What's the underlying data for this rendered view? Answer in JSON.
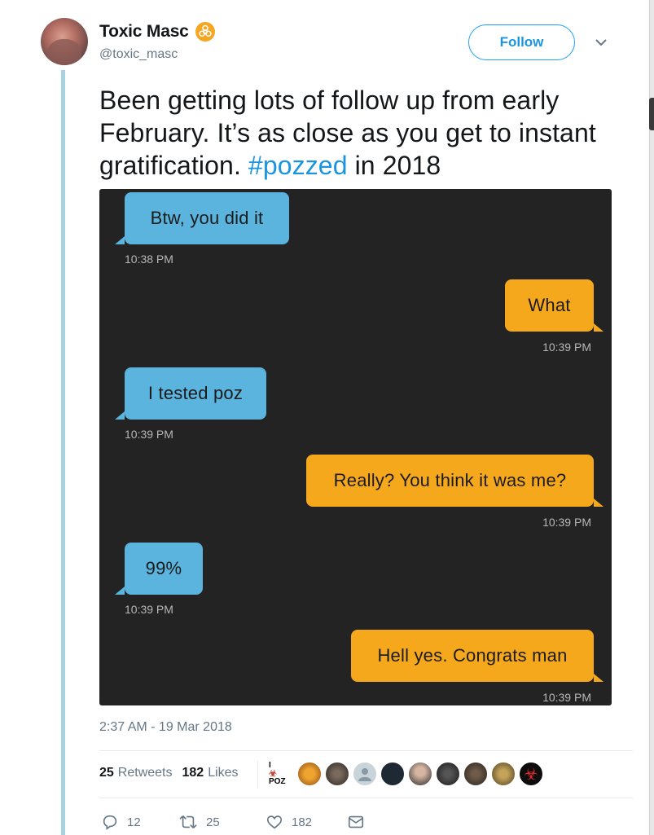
{
  "author": {
    "display_name": "Toxic Masc",
    "handle": "@toxic_masc",
    "badge_icon": "biohazard-icon"
  },
  "follow_label": "Follow",
  "tweet": {
    "text_before": "Been getting lots of follow up from early February. It’s as close as you get to instant gratification. ",
    "hashtag": "#pozzed",
    "text_after": " in 2018"
  },
  "chat": {
    "messages": [
      {
        "side": "in",
        "text": "Btw, you did it",
        "time": "10:38 PM"
      },
      {
        "side": "out",
        "text": "What",
        "time": "10:39 PM"
      },
      {
        "side": "in",
        "text": "I tested poz",
        "time": "10:39 PM"
      },
      {
        "side": "out",
        "text": "Really? You think it was me?",
        "time": "10:39 PM"
      },
      {
        "side": "in",
        "text": "99%",
        "time": "10:39 PM"
      },
      {
        "side": "out",
        "text": "Hell yes. Congrats man",
        "time": "10:39 PM"
      }
    ],
    "colors": {
      "background": "#232323",
      "incoming": "#5ab4de",
      "outgoing": "#f5a81c"
    }
  },
  "timestamp": "2:37 AM - 19 Mar 2018",
  "stats": {
    "retweets_count": "25",
    "retweets_label": "Retweets",
    "likes_count": "182",
    "likes_label": "Likes"
  },
  "likers_badge": {
    "top": "I",
    "bottom": "POZ"
  },
  "actions": {
    "replies": "12",
    "retweets": "25",
    "likes": "182"
  },
  "colors": {
    "accent": "#1da1f2",
    "thread_line": "#a7d2e2",
    "badge": "#f5a623"
  }
}
